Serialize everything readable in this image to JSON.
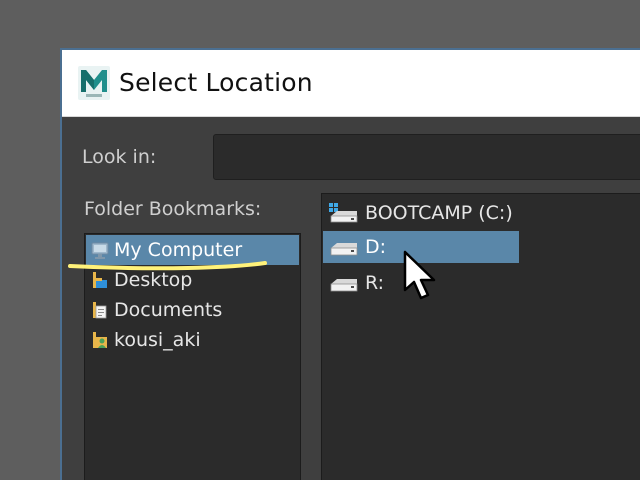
{
  "dialog": {
    "title": "Select Location",
    "app_icon": "maya-icon",
    "app_icon_letter": "M"
  },
  "look_in": {
    "label": "Look in:",
    "value": ""
  },
  "bookmarks": {
    "label": "Folder Bookmarks:",
    "items": [
      {
        "label": "My Computer",
        "icon": "computer-icon",
        "selected": true
      },
      {
        "label": "Desktop",
        "icon": "desktop-icon",
        "selected": false
      },
      {
        "label": "Documents",
        "icon": "documents-icon",
        "selected": false
      },
      {
        "label": "kousi_aki",
        "icon": "user-folder-icon",
        "selected": false
      }
    ]
  },
  "files": {
    "items": [
      {
        "label": "BOOTCAMP (C:)",
        "icon": "system-drive-icon",
        "selected": false
      },
      {
        "label": "D:",
        "icon": "drive-icon",
        "selected": true
      },
      {
        "label": "R:",
        "icon": "drive-icon",
        "selected": false
      }
    ]
  },
  "colors": {
    "selection": "#5a87a9",
    "dialog_background": "#3f3f3f",
    "panel_background": "#2b2b2b",
    "annotation_highlight": "#fff27a"
  }
}
